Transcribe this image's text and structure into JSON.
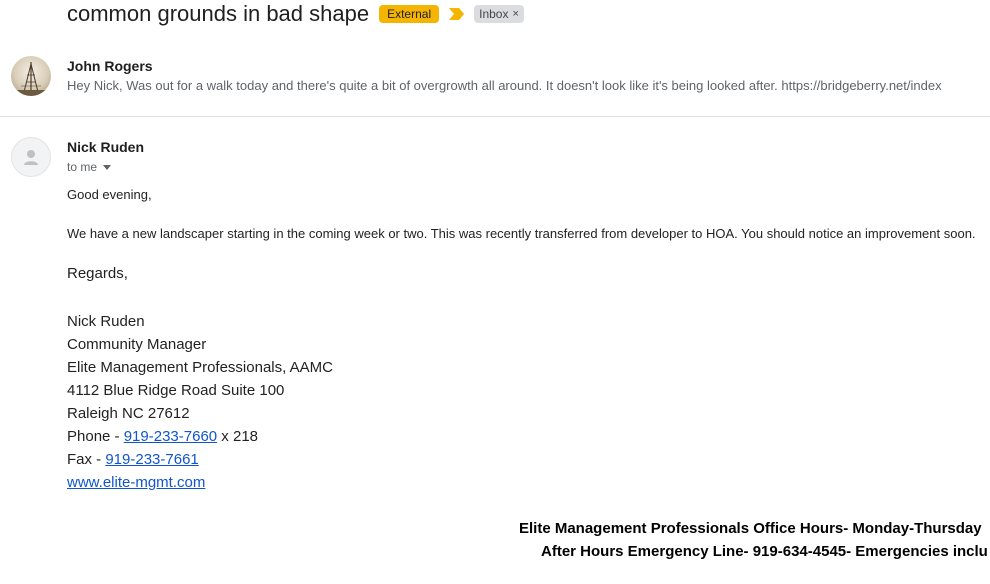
{
  "subject": {
    "text": "common grounds in bad shape",
    "external_label": "External",
    "inbox_label": "Inbox",
    "inbox_remove": "×"
  },
  "messages": [
    {
      "sender": "John Rogers",
      "snippet": "Hey Nick, Was out for a walk today and there's quite a bit of overgrowth all around. It doesn't look like it's being looked after. https://bridgeberry.net/index",
      "avatar_icon": "photo-avatar"
    },
    {
      "sender": "Nick Ruden",
      "to_label": "to me",
      "avatar_icon": "person-icon",
      "greeting": "Good evening,",
      "paragraph": "We have a new landscaper starting in the coming week or two. This was recently transferred from developer to HOA. You should notice an improvement soon.",
      "closing": "Regards,",
      "signature": {
        "name": "Nick Ruden",
        "title": "Community Manager",
        "company": "Elite Management Professionals, AAMC",
        "address1": "4112 Blue Ridge Road Suite 100",
        "address2": "Raleigh NC 27612",
        "phone_label": "Phone - ",
        "phone": "919-233-7660",
        "phone_ext": " x 218",
        "fax_label": "Fax - ",
        "fax": "919-233-7661",
        "website": "www.elite-mgmt.com"
      },
      "footer": {
        "line1": "Elite Management Professionals Office Hours- Monday-Thursday",
        "line2": "After Hours Emergency Line- 919-634-4545- Emergencies inclu"
      }
    }
  ],
  "colors": {
    "external_badge": "#f4b400",
    "importance_marker": "#f4b400",
    "link": "#1155cc"
  }
}
